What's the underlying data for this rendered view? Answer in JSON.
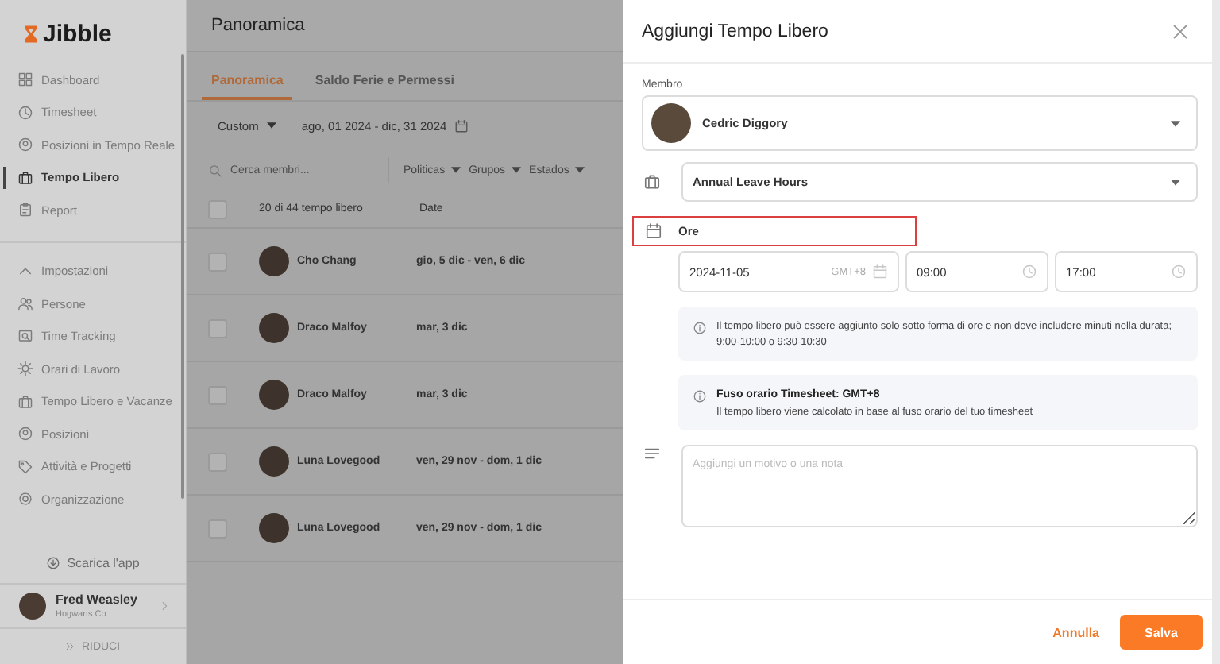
{
  "sidebar": {
    "logo": "Jibble",
    "nav": [
      {
        "label": "Dashboard",
        "kind": "grid",
        "selected": false
      },
      {
        "label": "Timesheet",
        "kind": "clock",
        "selected": false
      },
      {
        "label": "Posizioni in Tempo Reale",
        "kind": "pin",
        "selected": false
      },
      {
        "label": "Tempo Libero",
        "kind": "briefcase",
        "selected": true
      },
      {
        "label": "Report",
        "kind": "clipboard",
        "selected": false
      }
    ],
    "settings": {
      "label": "Impostazioni",
      "expanded": true,
      "items": [
        {
          "label": "Persone",
          "kind": "people"
        },
        {
          "label": "Time Tracking",
          "kind": "monitor"
        },
        {
          "label": "Orari di Lavoro",
          "kind": "sun"
        },
        {
          "label": "Tempo Libero e Vacanze",
          "kind": "briefcase"
        },
        {
          "label": "Posizioni",
          "kind": "pin"
        },
        {
          "label": "Attività e Progetti",
          "kind": "tag"
        },
        {
          "label": "Organizzazione",
          "kind": "gear"
        }
      ]
    },
    "download": "Scarica l'app",
    "user": {
      "name": "Fred Weasley",
      "org": "Hogwarts Co"
    },
    "collapse": "RIDUCI"
  },
  "main": {
    "title": "Panoramica",
    "tabs": [
      {
        "label": "Panoramica",
        "selected": true
      },
      {
        "label": "Saldo Ferie e Permessi",
        "selected": false
      }
    ],
    "range": {
      "preset": "Custom",
      "dates": "ago, 01 2024 - dic, 31 2024"
    },
    "search": {
      "placeholder": "Cerca membri..."
    },
    "filters": [
      "Politicas",
      "Grupos",
      "Estados"
    ],
    "table": {
      "all_checked": false,
      "columns": [
        "20 di 44 tempo libero",
        "Date"
      ],
      "rows": [
        {
          "name": "Cho Chang",
          "dates": "gio, 5 dic - ven, 6 dic",
          "checked": false
        },
        {
          "name": "Draco Malfoy",
          "dates": "mar, 3 dic",
          "checked": false
        },
        {
          "name": "Draco Malfoy",
          "dates": "mar, 3 dic",
          "checked": false
        },
        {
          "name": "Luna Lovegood",
          "dates": "ven, 29 nov - dom, 1 dic",
          "checked": false
        },
        {
          "name": "Luna Lovegood",
          "dates": "ven, 29 nov - dom, 1 dic",
          "checked": false
        }
      ]
    }
  },
  "dialog": {
    "title": "Aggiungi Tempo Libero",
    "member_label": "Membro",
    "member": "Cedric Diggory",
    "leave_type": "Annual Leave Hours",
    "duration": {
      "label": "Ore",
      "highlighted": true
    },
    "date": "2024-11-05",
    "timezone": "GMT+8",
    "start": "09:00",
    "end": "17:00",
    "notices": [
      {
        "text": "Il tempo libero può essere aggiunto solo sotto forma di ore e non deve includere minuti nella durata; 9:00-10:00 o 9:30-10:30"
      },
      {
        "title": "Fuso orario Timesheet: GMT+8",
        "text": "Il tempo libero viene calcolato in base al fuso orario del tuo timesheet"
      }
    ],
    "note": {
      "placeholder": "Aggiungi un motivo o una nota"
    },
    "cancel": "Annulla",
    "save": "Salva"
  }
}
